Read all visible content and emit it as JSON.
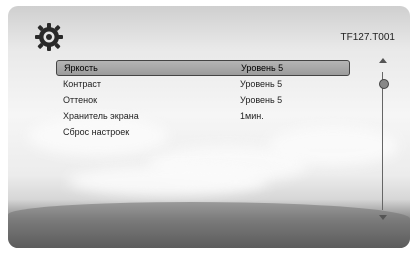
{
  "header": {
    "icon": "gear-icon",
    "model_id": "TF127.T001"
  },
  "menu": {
    "items": [
      {
        "label": "Яркость",
        "value": "Уровень 5",
        "selected": true
      },
      {
        "label": "Контраст",
        "value": "Уровень 5",
        "selected": false
      },
      {
        "label": "Оттенок",
        "value": "Уровень 5",
        "selected": false
      },
      {
        "label": "Хранитель экрана",
        "value": "1мин.",
        "selected": false
      },
      {
        "label": "Сброс настроек",
        "value": "",
        "selected": false
      }
    ]
  },
  "scrollbar": {
    "position": 0.05
  },
  "colors": {
    "text": "#222222",
    "selection": "#a9a9a9"
  }
}
